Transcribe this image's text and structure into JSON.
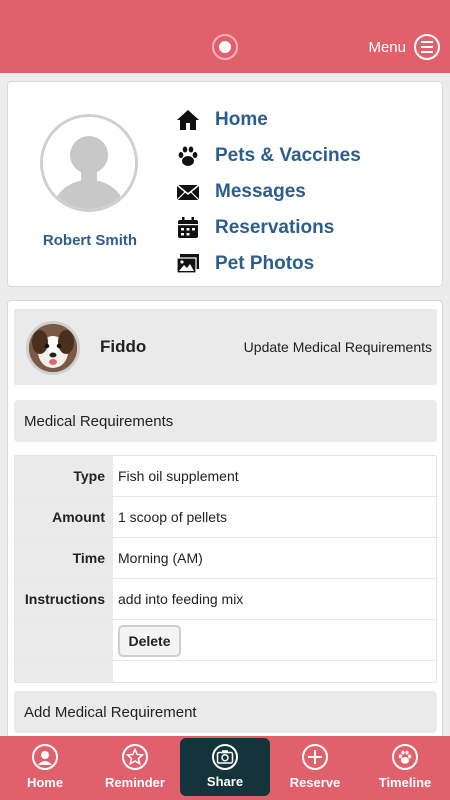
{
  "header": {
    "menu_label": "Menu"
  },
  "profile": {
    "name": "Robert Smith"
  },
  "nav": {
    "items": [
      {
        "label": "Home",
        "icon": "home-icon"
      },
      {
        "label": "Pets & Vaccines",
        "icon": "paw-icon"
      },
      {
        "label": "Messages",
        "icon": "envelope-icon"
      },
      {
        "label": "Reservations",
        "icon": "calendar-icon"
      },
      {
        "label": "Pet Photos",
        "icon": "photos-icon"
      }
    ]
  },
  "pet": {
    "name": "Fiddo",
    "update_label": "Update Medical Requirements"
  },
  "medical": {
    "section_title": "Medical Requirements",
    "rows": [
      {
        "label": "Type",
        "value": "Fish oil supplement"
      },
      {
        "label": "Amount",
        "value": "1 scoop of pellets"
      },
      {
        "label": "Time",
        "value": "Morning (AM)"
      },
      {
        "label": "Instructions",
        "value": "add into feeding mix"
      }
    ],
    "delete_label": "Delete",
    "add_label": "Add Medical Requirement"
  },
  "tabs": [
    {
      "label": "Home",
      "icon": "user-icon"
    },
    {
      "label": "Reminder",
      "icon": "star-icon"
    },
    {
      "label": "Share",
      "icon": "camera-icon",
      "active": true
    },
    {
      "label": "Reserve",
      "icon": "plus-icon"
    },
    {
      "label": "Timeline",
      "icon": "paw-icon"
    }
  ],
  "colors": {
    "accent": "#e0616c",
    "link": "#2b5e8e",
    "active_tab": "#15333b"
  }
}
